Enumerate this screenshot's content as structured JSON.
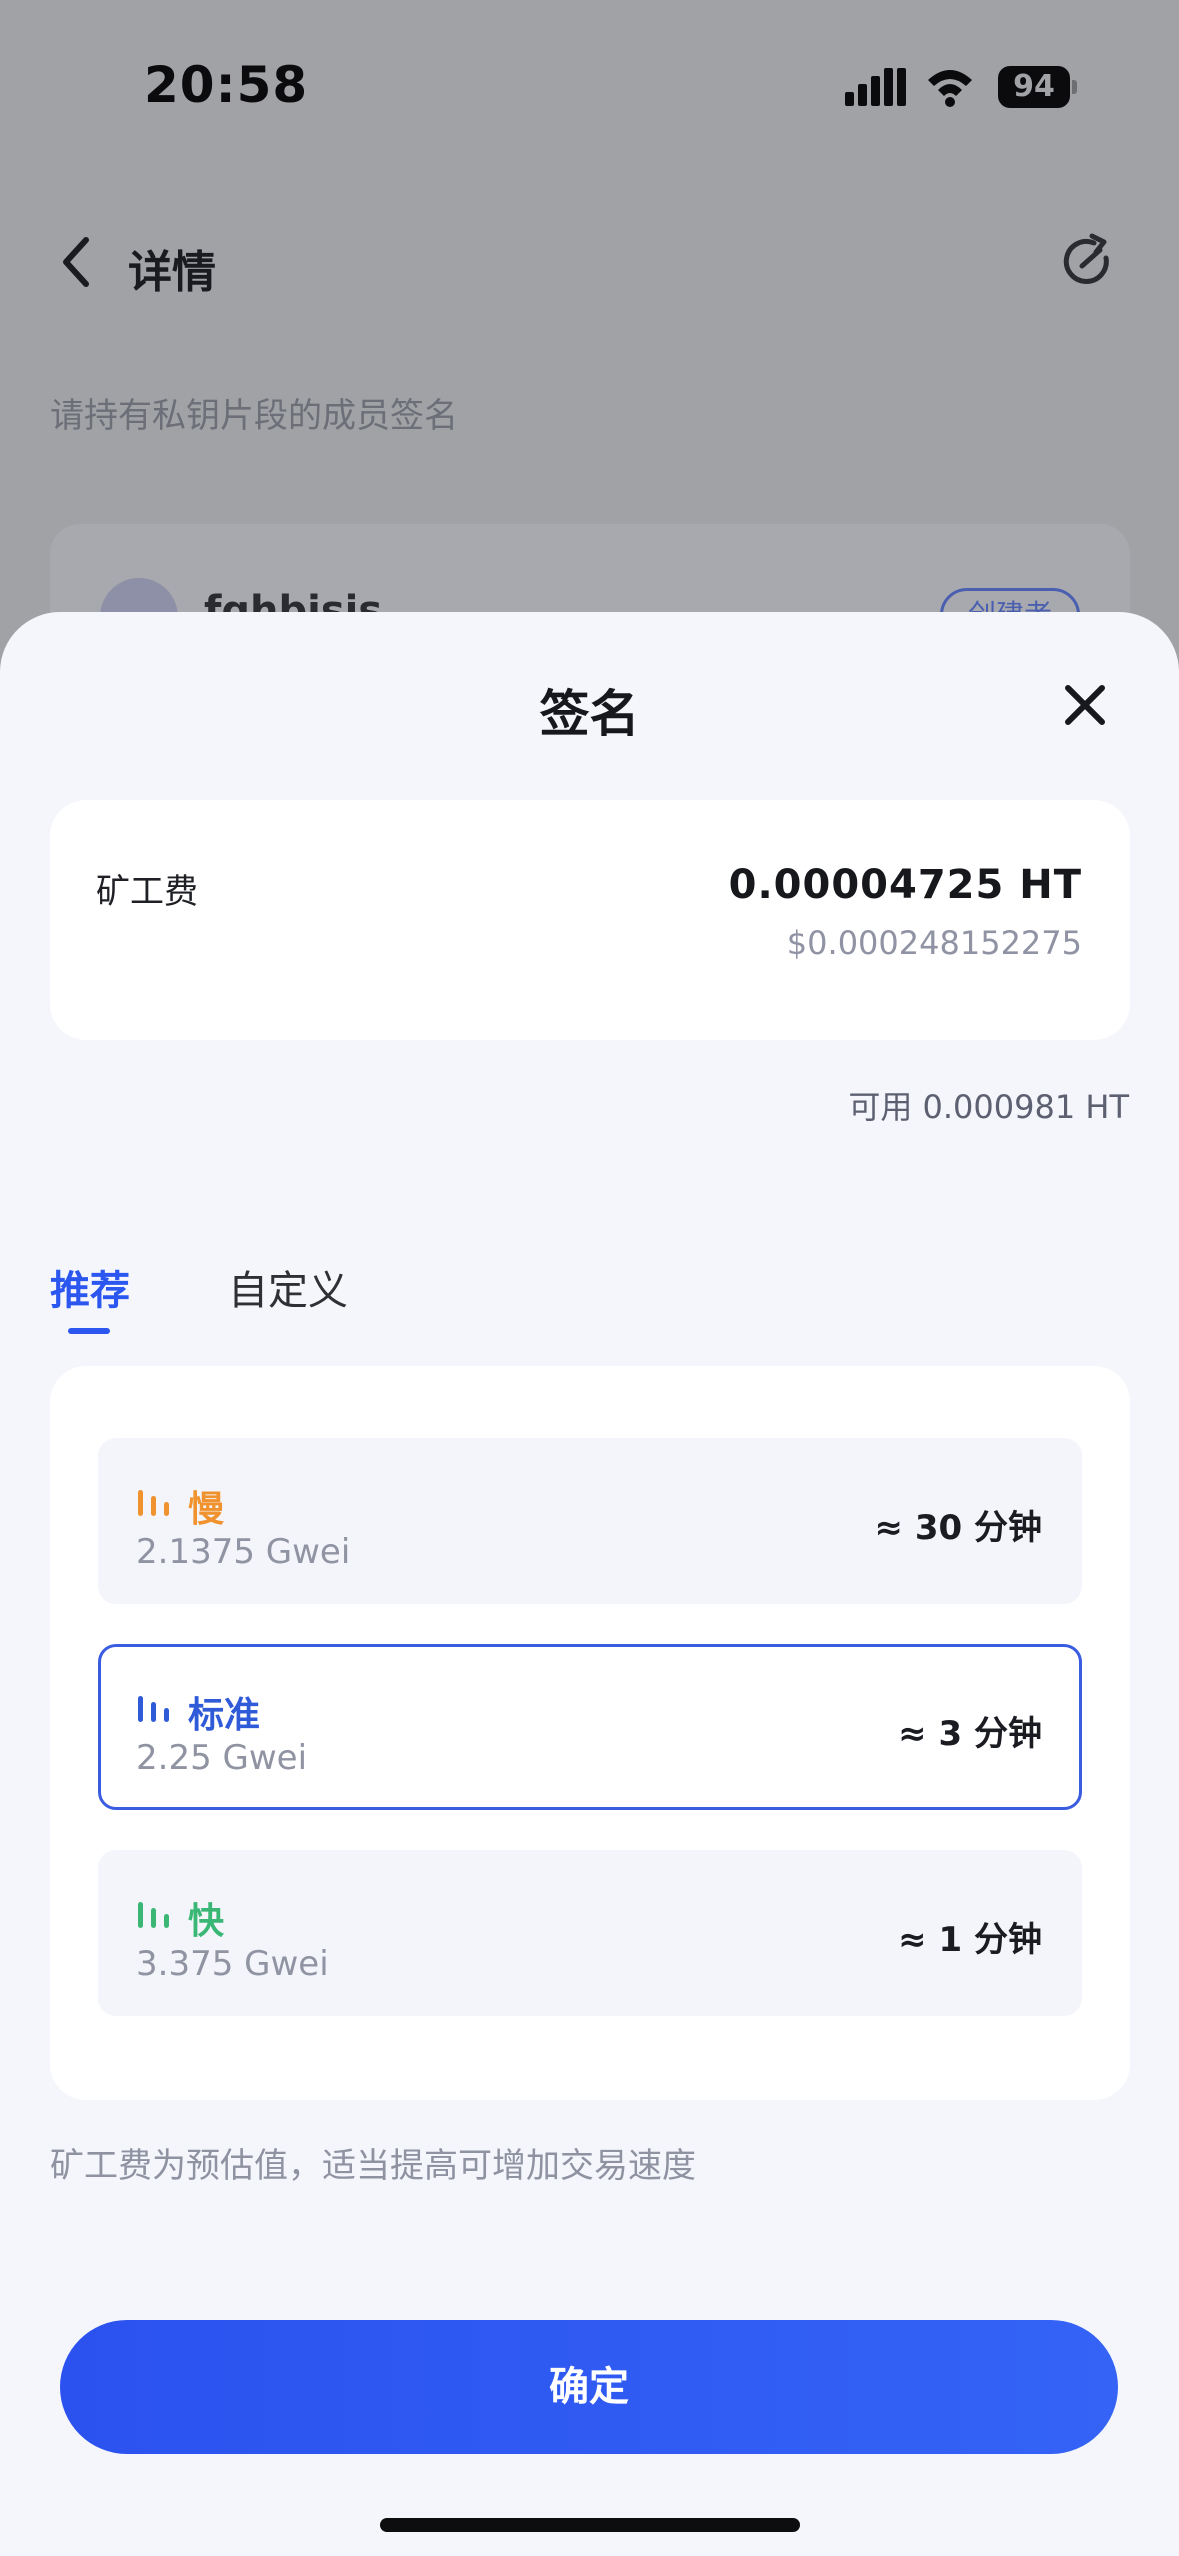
{
  "status_bar": {
    "time": "20:58",
    "battery": "94"
  },
  "background": {
    "nav_title": "详情",
    "hint": "请持有私钥片段的成员签名",
    "member_name": "fqhbisis",
    "member_badge": "创建者"
  },
  "sheet": {
    "title": "签名",
    "fee": {
      "label": "矿工费",
      "amount": "0.00004725 HT",
      "usd": "$0.000248152275"
    },
    "available": "可用 0.000981 HT",
    "tabs": [
      {
        "label": "推荐",
        "active": true
      },
      {
        "label": "自定义",
        "active": false
      }
    ],
    "speed_options": [
      {
        "name": "慢",
        "gwei": "2.1375 Gwei",
        "time": "≈ 30 分钟",
        "color": "#f0922e",
        "selected": false
      },
      {
        "name": "标准",
        "gwei": "2.25 Gwei",
        "time": "≈ 3 分钟",
        "color": "#2f5ad8",
        "selected": true
      },
      {
        "name": "快",
        "gwei": "3.375 Gwei",
        "time": "≈ 1 分钟",
        "color": "#3ab774",
        "selected": false
      }
    ],
    "note": "矿工费为预估值，适当提高可增加交易速度",
    "confirm_label": "确定"
  },
  "colors": {
    "accent": "#2c56f0",
    "slow": "#f0922e",
    "standard": "#2f5ad8",
    "fast": "#3ab774"
  },
  "icons": [
    "back-arrow-icon",
    "refresh-icon",
    "close-icon",
    "signal-icon",
    "wifi-icon",
    "battery-icon",
    "speed-bars-icon"
  ]
}
